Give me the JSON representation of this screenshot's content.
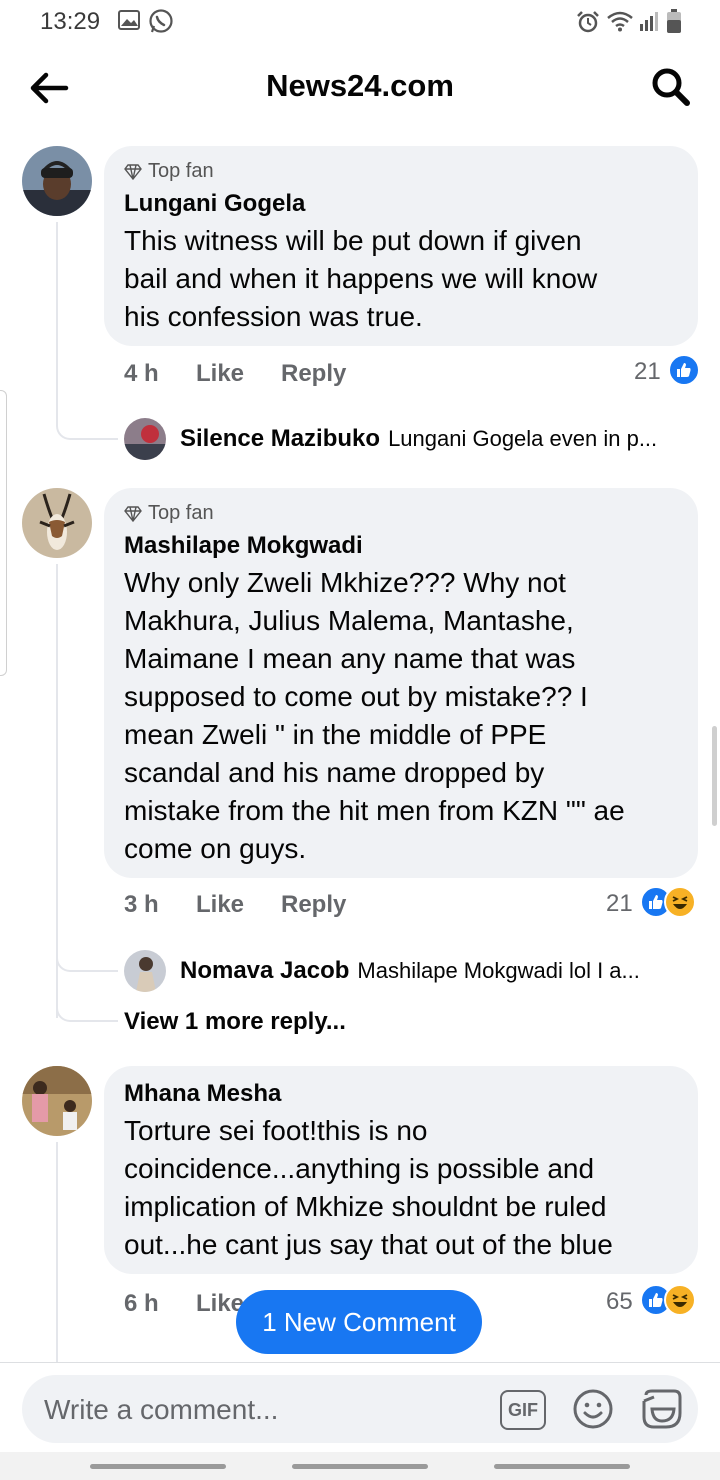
{
  "status_bar": {
    "time": "13:29"
  },
  "header": {
    "title": "News24.com"
  },
  "comments": [
    {
      "badge": "Top fan",
      "author": "Lungani Gogela",
      "text": "This witness will be put down if given\nbail and when it happens we will know\nhis confession was true.",
      "time": "4 h",
      "like": "Like",
      "reply": "Reply",
      "reaction_count": "21",
      "reply_preview": {
        "name": "Silence Mazibuko",
        "snippet": "Lungani Gogela even in p..."
      }
    },
    {
      "badge": "Top fan",
      "author": "Mashilape Mokgwadi",
      "text": "Why only Zweli Mkhize??? Why not\nMakhura, Julius Malema, Mantashe,\nMaimane I mean any name that was\nsupposed to come out by mistake?? I\nmean Zweli \" in the middle of PPE\nscandal and his name dropped by\nmistake from the hit men from KZN \"\" ae\ncome on guys.",
      "time": "3 h",
      "like": "Like",
      "reply": "Reply",
      "reaction_count": "21",
      "reply_preview": {
        "name": "Nomava Jacob",
        "snippet": "Mashilape Mokgwadi lol I a..."
      },
      "view_more": "View 1 more reply..."
    },
    {
      "author": "Mhana Mesha",
      "text": "Torture sei foot!this is no\ncoincidence...anything is possible and\nimplication of Mkhize shouldnt be ruled\nout...he cant jus say that out of the blue",
      "time": "6 h",
      "like": "Like",
      "reaction_count": "65"
    }
  ],
  "new_comment_pill": "1 New Comment",
  "composer": {
    "placeholder": "Write a comment...",
    "gif_label": "GIF"
  },
  "colors": {
    "accent": "#1877f2",
    "bubble": "#f0f2f5",
    "muted": "#65676b",
    "haha": "#f7b125"
  },
  "icons": [
    "back-arrow-icon",
    "search-icon",
    "diamond-icon",
    "like-icon",
    "haha-icon",
    "emoji-icon",
    "sticker-icon"
  ]
}
